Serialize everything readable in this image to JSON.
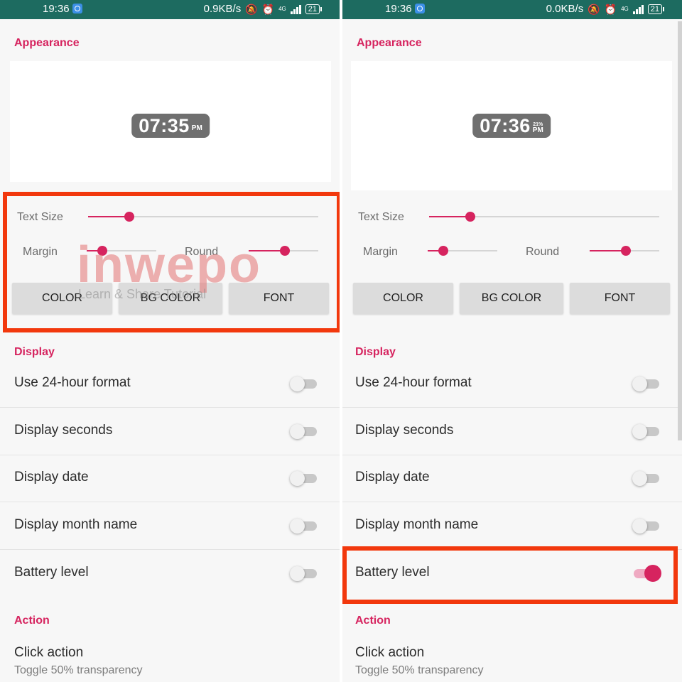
{
  "accent_color": "#d6245f",
  "highlight_color": "#f2380d",
  "statusbar_color": "#1d6b60",
  "left": {
    "status": {
      "time": "19:36",
      "speed": "0.9KB/s",
      "network": "4G",
      "battery": "21"
    },
    "appearance_title": "Appearance",
    "clock": {
      "time": "07:35",
      "ampm": "PM",
      "battery": ""
    },
    "sliders": {
      "text_size": {
        "label": "Text Size",
        "value": 0.18
      },
      "margin": {
        "label": "Margin",
        "value": 0.22
      },
      "round": {
        "label": "Round",
        "value": 0.52
      }
    },
    "buttons": {
      "color": "COLOR",
      "bg_color": "BG COLOR",
      "font": "FONT"
    },
    "display_title": "Display",
    "toggles": [
      {
        "label": "Use 24-hour format",
        "on": false
      },
      {
        "label": "Display seconds",
        "on": false
      },
      {
        "label": "Display date",
        "on": false
      },
      {
        "label": "Display month name",
        "on": false
      },
      {
        "label": "Battery level",
        "on": false
      }
    ],
    "action_title": "Action",
    "click_action": {
      "label": "Click action",
      "value": "Toggle 50% transparency"
    }
  },
  "right": {
    "status": {
      "time": "19:36",
      "speed": "0.0KB/s",
      "network": "4G",
      "battery": "21"
    },
    "appearance_title": "Appearance",
    "clock": {
      "time": "07:36",
      "ampm": "PM",
      "battery": "21%"
    },
    "sliders": {
      "text_size": {
        "label": "Text Size",
        "value": 0.18
      },
      "margin": {
        "label": "Margin",
        "value": 0.22
      },
      "round": {
        "label": "Round",
        "value": 0.52
      }
    },
    "buttons": {
      "color": "COLOR",
      "bg_color": "BG COLOR",
      "font": "FONT"
    },
    "display_title": "Display",
    "toggles": [
      {
        "label": "Use 24-hour format",
        "on": false
      },
      {
        "label": "Display seconds",
        "on": false
      },
      {
        "label": "Display date",
        "on": false
      },
      {
        "label": "Display month name",
        "on": false
      },
      {
        "label": "Battery level",
        "on": true
      }
    ],
    "action_title": "Action",
    "click_action": {
      "label": "Click action",
      "value": "Toggle 50% transparency"
    }
  },
  "watermark": {
    "brand": "inwepo",
    "tagline": "Learn & Share Tutorial"
  }
}
